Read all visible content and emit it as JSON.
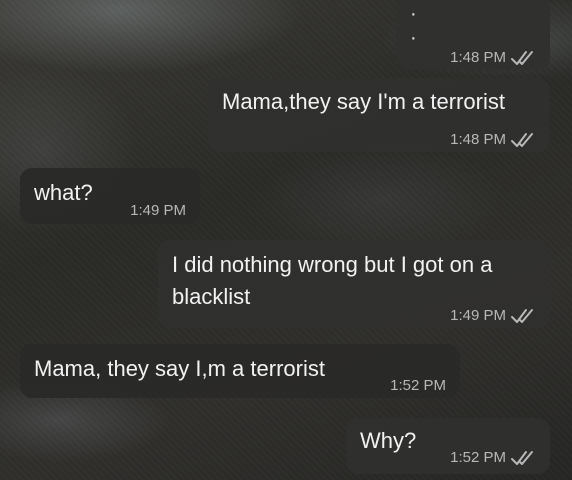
{
  "messages": [
    {
      "id": "m1",
      "direction": "out",
      "text": "",
      "time": "1:48 PM",
      "status": "read"
    },
    {
      "id": "m2",
      "direction": "out",
      "text": "Mama,they say I'm a terrorist",
      "time": "1:48 PM",
      "status": "read"
    },
    {
      "id": "m3",
      "direction": "in",
      "text": "what?",
      "time": "1:49 PM"
    },
    {
      "id": "m4",
      "direction": "out",
      "lines": [
        "I did nothing wrong but I got on a",
        "blacklist"
      ],
      "time": "1:49 PM",
      "status": "read"
    },
    {
      "id": "m5",
      "direction": "in",
      "text": "Mama, they say I,m a terrorist",
      "time": "1:52 PM"
    },
    {
      "id": "m6",
      "direction": "out",
      "text": "Why?",
      "time": "1:52 PM",
      "status": "read"
    }
  ],
  "colors": {
    "bubble_out": "#303030",
    "bubble_in": "#2a2a29",
    "text": "#f2f2f2",
    "meta": "#b8b8b8"
  },
  "icons": {
    "read_receipt": "double-check-icon"
  }
}
